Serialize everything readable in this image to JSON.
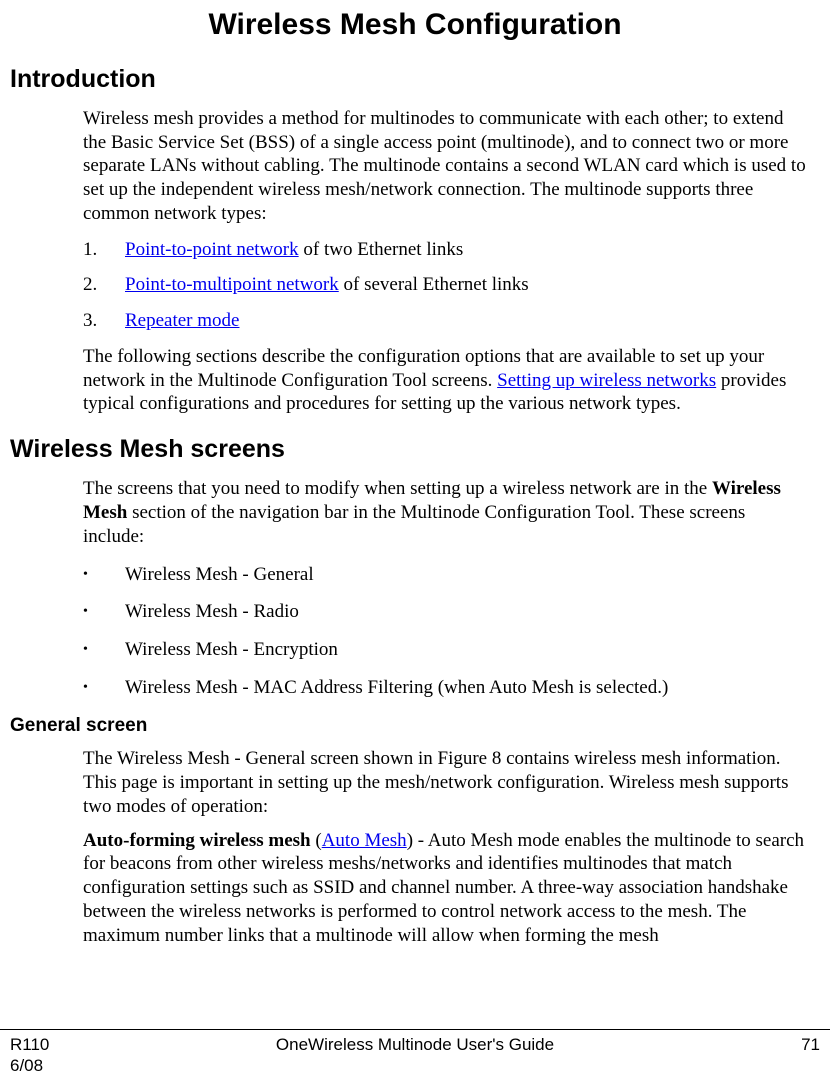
{
  "title": "Wireless Mesh Configuration",
  "introduction": {
    "heading": "Introduction",
    "para1": "Wireless mesh provides a method for multinodes to communicate with each other; to extend the Basic Service Set (BSS) of a single access point (multinode), and to connect two or more separate LANs without cabling.  The multinode contains a second WLAN card which is used to set up the independent wireless mesh/network connection.  The multinode supports three common network types:",
    "items": [
      {
        "num": "1.",
        "link": "Point-to-point network",
        "rest": " of two Ethernet links"
      },
      {
        "num": "2.",
        "link": "Point-to-multipoint network",
        "rest": " of several Ethernet links"
      },
      {
        "num": "3.",
        "link": "Repeater mode",
        "rest": ""
      }
    ],
    "para2a": "The following sections describe the configuration options that are available to set up your network in the Multinode Configuration Tool screens.  ",
    "para2_link": "Setting up wireless networks",
    "para2b": " provides typical configurations and procedures for setting up the various network types."
  },
  "screens": {
    "heading": "Wireless Mesh screens",
    "para1a": "The screens that you need to modify when setting up a wireless network are in the ",
    "para1_bold": "Wireless Mesh",
    "para1b": " section of the navigation bar in the Multinode Configuration Tool. These screens include:",
    "bullets": [
      "Wireless Mesh - General",
      "Wireless Mesh - Radio",
      "Wireless Mesh - Encryption",
      "Wireless Mesh - MAC Address Filtering (when Auto Mesh is selected.)"
    ]
  },
  "general": {
    "heading": "General screen",
    "para1": "The Wireless Mesh - General screen shown in Figure 8 contains wireless mesh information. This page is important in setting up the mesh/network configuration. Wireless mesh supports two modes of operation:",
    "para2_bold": "Auto-forming wireless mesh",
    "para2_open": " (",
    "para2_link": "Auto Mesh",
    "para2_close": ") - Auto Mesh mode enables the multinode to search for beacons from other wireless meshs/networks and identifies multinodes that match configuration settings such as SSID and channel number.  A three-way association handshake between the wireless networks is performed to control network access to the mesh.  The maximum number links that a multinode will allow when forming the mesh"
  },
  "footer": {
    "left1": "R110",
    "left2": "6/08",
    "center": "OneWireless Multinode User's Guide",
    "right": "71"
  }
}
